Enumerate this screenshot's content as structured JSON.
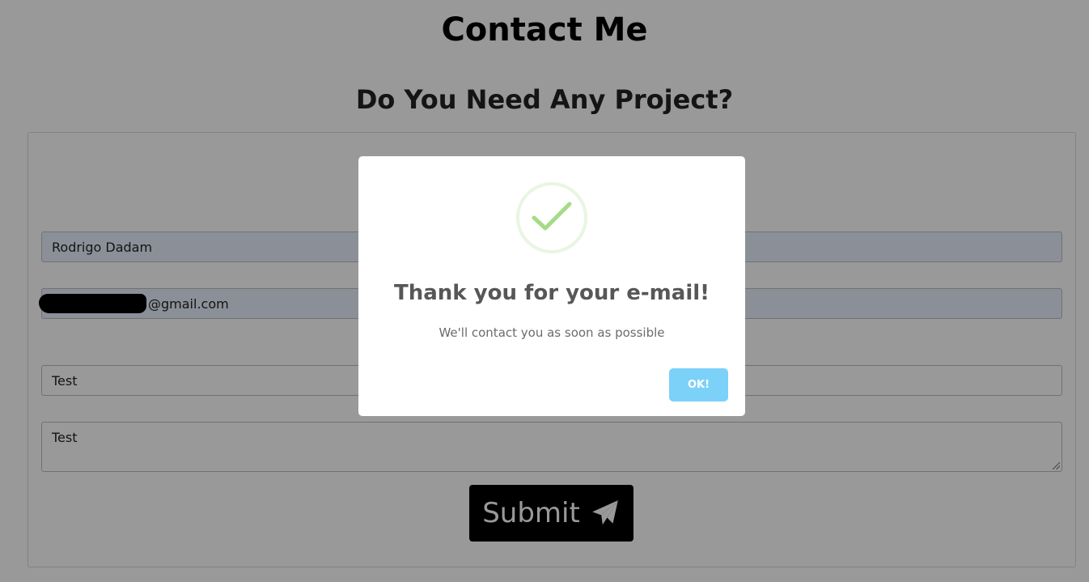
{
  "page": {
    "title": "Contact Me",
    "subtitle": "Do You Need Any Project?"
  },
  "form": {
    "name_value": "Rodrigo Dadam",
    "email_visible_suffix": "@gmail.com",
    "subject_value": "Test",
    "message_value": "Test",
    "submit_label": "Submit",
    "submit_icon": "paper-plane-icon"
  },
  "modal": {
    "icon": "success-check-icon",
    "title": "Thank you for your e-mail!",
    "text": "We'll contact you as soon as possible",
    "ok_label": "OK!"
  },
  "colors": {
    "overlay": "rgba(0,0,0,0.4)",
    "ok_button": "#7cd1f9",
    "success_check": "#a5dc86",
    "autofill_field": "#e8f0fe",
    "submit_button": "#000000"
  }
}
